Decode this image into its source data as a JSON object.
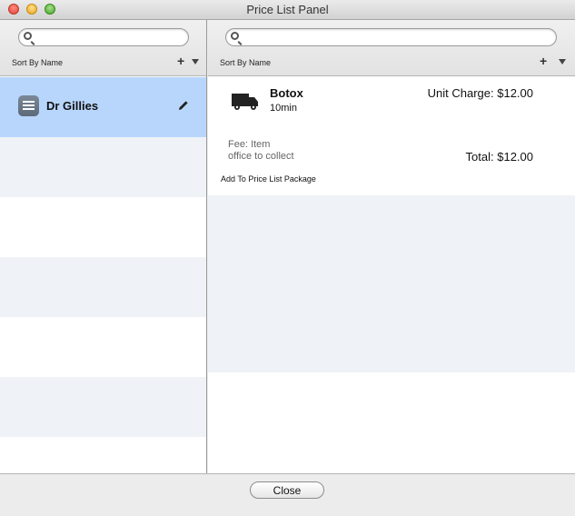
{
  "window": {
    "title": "Price List Panel"
  },
  "left_pane": {
    "search": {
      "value": "",
      "placeholder": ""
    },
    "sort_label": "Sort By Name",
    "add_symbol": "+",
    "lists": [
      {
        "name": "Dr Gillies",
        "icon": "list-icon",
        "selected": true
      }
    ]
  },
  "right_pane": {
    "search": {
      "value": "",
      "placeholder": ""
    },
    "sort_label": "Sort By Name",
    "add_symbol": "+",
    "item": {
      "icon": "truck-icon",
      "name": "Botox",
      "duration": "10min",
      "unit_charge": "Unit Charge: $12.00",
      "fee_type": "Fee: Item",
      "fee_note": "office to collect",
      "total": "Total: $12.00",
      "add_link": "Add To Price List Package"
    }
  },
  "footer": {
    "close_label": "Close"
  },
  "colors": {
    "selection": "#b8d6fc",
    "alt_row": "#eff2f7"
  }
}
